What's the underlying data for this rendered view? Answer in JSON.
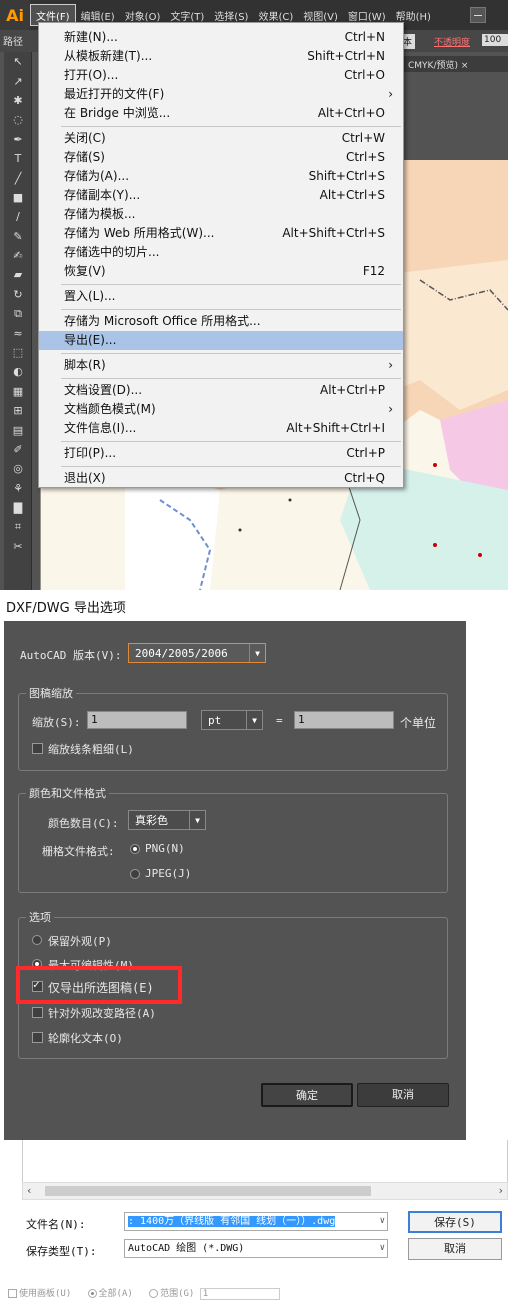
{
  "app": {
    "logo": "Ai",
    "menus": [
      "文件(F)",
      "编辑(E)",
      "对象(O)",
      "文字(T)",
      "选择(S)",
      "效果(C)",
      "视图(V)",
      "窗口(W)",
      "帮助(H)"
    ],
    "active_menu": "文件(F)",
    "control_bar": {
      "path_label": "路径",
      "ben_label": "本",
      "opacity_label": "不透明度",
      "opacity_value": "100"
    },
    "doc_tab": "CMYK/预览)  ×"
  },
  "file_menu": [
    {
      "label": "新建(N)...",
      "shortcut": "Ctrl+N"
    },
    {
      "label": "从模板新建(T)...",
      "shortcut": "Shift+Ctrl+N"
    },
    {
      "label": "打开(O)...",
      "shortcut": "Ctrl+O"
    },
    {
      "label": "最近打开的文件(F)",
      "shortcut": "",
      "submenu": true
    },
    {
      "label": "在 Bridge 中浏览...",
      "shortcut": "Alt+Ctrl+O"
    },
    {
      "label": "关闭(C)",
      "shortcut": "Ctrl+W"
    },
    {
      "label": "存储(S)",
      "shortcut": "Ctrl+S"
    },
    {
      "label": "存储为(A)...",
      "shortcut": "Shift+Ctrl+S"
    },
    {
      "label": "存储副本(Y)...",
      "shortcut": "Alt+Ctrl+S"
    },
    {
      "label": "存储为模板...",
      "shortcut": ""
    },
    {
      "label": "存储为 Web 所用格式(W)...",
      "shortcut": "Alt+Shift+Ctrl+S"
    },
    {
      "label": "存储选中的切片...",
      "shortcut": ""
    },
    {
      "label": "恢复(V)",
      "shortcut": "F12"
    },
    {
      "label": "置入(L)...",
      "shortcut": ""
    },
    {
      "label": "存储为 Microsoft Office 所用格式...",
      "shortcut": ""
    },
    {
      "label": "导出(E)...",
      "shortcut": "",
      "highlighted": true
    },
    {
      "label": "脚本(R)",
      "shortcut": "",
      "submenu": true
    },
    {
      "label": "文档设置(D)...",
      "shortcut": "Alt+Ctrl+P"
    },
    {
      "label": "文档颜色模式(M)",
      "shortcut": "",
      "submenu": true
    },
    {
      "label": "文件信息(I)...",
      "shortcut": "Alt+Shift+Ctrl+I"
    },
    {
      "label": "打印(P)...",
      "shortcut": "Ctrl+P"
    },
    {
      "label": "退出(X)",
      "shortcut": "Ctrl+Q"
    }
  ],
  "dialog": {
    "title": "DXF/DWG 导出选项",
    "autocad_label": "AutoCAD 版本(V):",
    "autocad_value": "2004/2005/2006",
    "scale_group": {
      "title": "图稿缩放",
      "scale_label": "缩放(S):",
      "scale_value": "1",
      "unit_value": "pt",
      "equals": "=",
      "units_value": "1",
      "units_label": "个单位",
      "scale_lines_label": "缩放线条粗细(L)",
      "scale_lines_checked": false
    },
    "color_group": {
      "title": "颜色和文件格式",
      "colors_label": "颜色数目(C):",
      "colors_value": "真彩色",
      "raster_label": "栅格文件格式:",
      "png_label": "PNG(N)",
      "jpeg_label": "JPEG(J)",
      "selected_format": "PNG"
    },
    "options_group": {
      "title": "选项",
      "preserve_label": "保留外观(P)",
      "max_edit_label": "最大可编辑性(M)",
      "selected_mode": "max_edit",
      "export_selected_label": "仅导出所选图稿(E)",
      "export_selected_checked": true,
      "alter_paths_label": "针对外观改变路径(A)",
      "alter_paths_checked": false,
      "outline_text_label": "轮廓化文本(O)",
      "outline_text_checked": false
    },
    "ok_label": "确定",
    "cancel_label": "取消",
    "highlight_color": "#ff2a2a"
  },
  "save_dialog": {
    "filename_label": "文件名(N):",
    "filename_value": ": 1400万（界线版 有邻国 线划（一））.dwg",
    "filetype_label": "保存类型(T):",
    "filetype_value": "AutoCAD 绘图 (*.DWG)",
    "save_label": "保存(S)",
    "cancel_label": "取消",
    "use_artboards_label": "使用画板(U)",
    "all_label": "全部(A)",
    "range_label": "范围(G)",
    "range_value": "1"
  }
}
